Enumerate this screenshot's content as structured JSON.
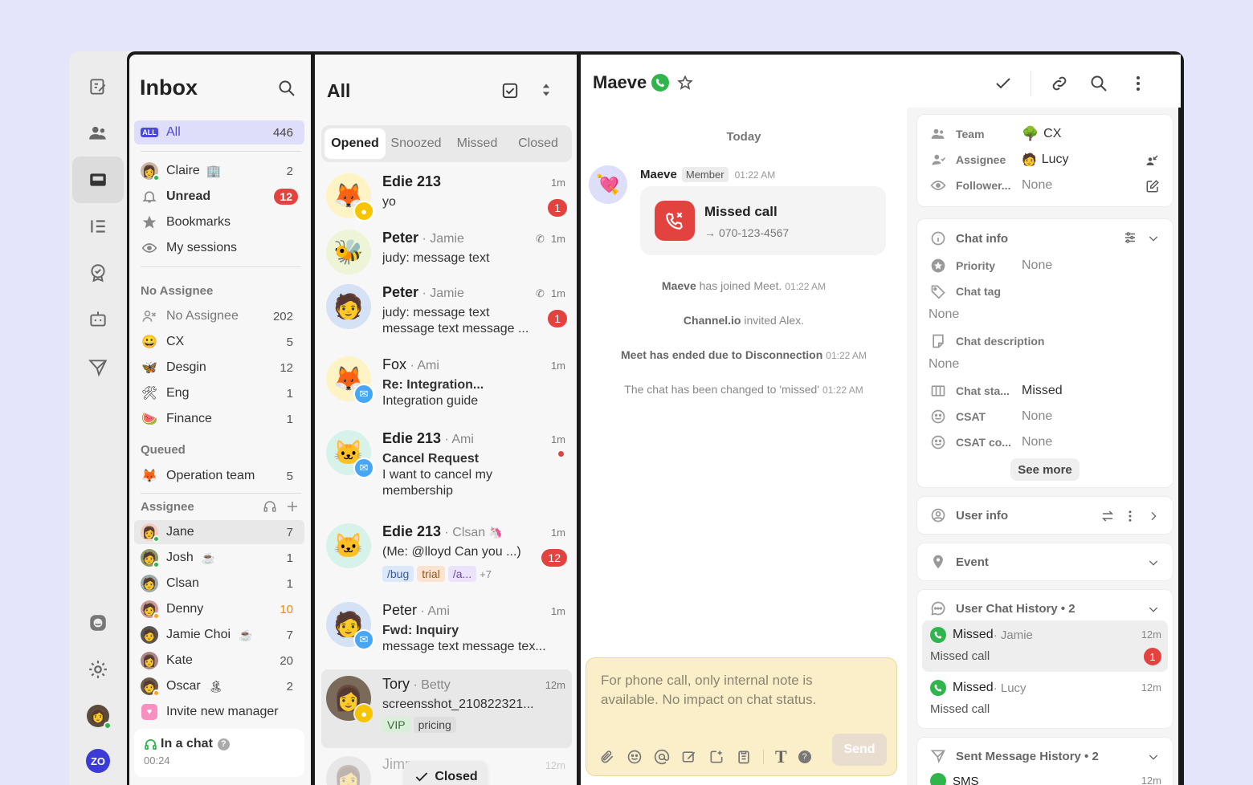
{
  "rail": {
    "items": [
      "compose-icon",
      "contacts-icon",
      "inbox-icon",
      "list-icon",
      "badge-icon",
      "bot-icon",
      "send-icon",
      "channel-icon",
      "settings-icon"
    ],
    "profile_label": "ZO"
  },
  "inbox": {
    "title": "Inbox",
    "all": {
      "label": "All",
      "count": "446",
      "icon_text": "ALL"
    },
    "items": [
      {
        "label": "Claire",
        "count": "2"
      },
      {
        "label": "Unread",
        "count": "12"
      },
      {
        "label": "Bookmarks",
        "count": ""
      },
      {
        "label": "My sessions",
        "count": ""
      }
    ],
    "no_assignee_header": "No Assignee",
    "teams": [
      {
        "label": "No Assignee",
        "count": "202",
        "emoji": ""
      },
      {
        "label": "CX",
        "count": "5",
        "emoji": "😀"
      },
      {
        "label": "Desgin",
        "count": "12",
        "emoji": "🦋"
      },
      {
        "label": "Eng",
        "count": "1",
        "emoji": "🛠"
      },
      {
        "label": "Finance",
        "count": "1",
        "emoji": "🍉"
      }
    ],
    "queued_header": "Queued",
    "queued": [
      {
        "label": "Operation team",
        "count": "5",
        "emoji": "🦊"
      }
    ],
    "assignee_header": "Assignee",
    "assignees": [
      {
        "label": "Jane",
        "count": "7",
        "extra": ""
      },
      {
        "label": "Josh",
        "count": "1",
        "extra": "☕"
      },
      {
        "label": "Clsan",
        "count": "1",
        "extra": ""
      },
      {
        "label": "Denny",
        "count": "10",
        "extra": ""
      },
      {
        "label": "Jamie Choi",
        "count": "7",
        "extra": "☕"
      },
      {
        "label": "Kate",
        "count": "20",
        "extra": ""
      },
      {
        "label": "Oscar",
        "count": "2",
        "extra": "🏝"
      }
    ],
    "invite": "Invite new manager",
    "status": {
      "label": "In a chat",
      "time": "00:24"
    }
  },
  "list": {
    "title": "All",
    "tabs": [
      "Opened",
      "Snoozed",
      "Missed",
      "Closed"
    ],
    "conversations": [
      {
        "name": "Edie 213",
        "sub": "",
        "time": "1m",
        "line1": "yo",
        "line2": "",
        "badge": "1",
        "emoji": "🦊"
      },
      {
        "name": "Peter",
        "sub": " · Jamie",
        "time": "1m",
        "line1": "judy: message text",
        "line2": "",
        "badge": "",
        "emoji": "🐝"
      },
      {
        "name": "Peter",
        "sub": " · Jamie",
        "time": "1m",
        "line1": "judy: message text",
        "line2": "message text message ...",
        "badge": "1",
        "emoji": "🧑"
      },
      {
        "name": "Fox",
        "sub": " · Ami",
        "time": "1m",
        "line1": "Re: Integration...",
        "line2": "Integration guide",
        "badge": "",
        "emoji": "🦊"
      },
      {
        "name": "Edie 213",
        "sub": " · Ami",
        "time": "1m",
        "line1": "Cancel Request",
        "line2": "I want to cancel my",
        "line3": "membership",
        "badge": "",
        "emoji": "🐱"
      },
      {
        "name": "Edie 213",
        "sub": " · Clsan",
        "time": "1m",
        "line1": "(Me: @lloyd Can you ...)",
        "line2": "",
        "badge": "12",
        "emoji": "🐱",
        "tags": [
          "/bug",
          "trial",
          "/a..."
        ],
        "more": "+7"
      },
      {
        "name": "Peter",
        "sub": " · Ami",
        "time": "1m",
        "line1": "Fwd: Inquiry",
        "line2": "message text message tex...",
        "badge": "",
        "emoji": "🧑"
      },
      {
        "name": "Tory",
        "sub": " · Betty",
        "time": "12m",
        "line1": "screensshot_210822321...",
        "line2": "",
        "badge": "",
        "emoji": "👩",
        "tags": [
          "VIP",
          "pricing"
        ]
      },
      {
        "name": "Jimm",
        "sub": "",
        "time": "12m",
        "line1": "",
        "line2": "",
        "badge": "",
        "emoji": "👩"
      }
    ],
    "toast": "Closed"
  },
  "chat": {
    "name": "Maeve",
    "date_divider": "Today",
    "message": {
      "sender": "Maeve",
      "role": "Member",
      "time": "01:22 AM",
      "title": "Missed call",
      "number": "070-123-4567"
    },
    "system": [
      {
        "b": "Maeve",
        "text": " has joined Meet.",
        "time": "01:22 AM"
      },
      {
        "b": "Channel.io",
        "text": " invited Alex.",
        "time": ""
      },
      {
        "b": "Meet has ended due to Disconnection",
        "text": "",
        "time": "01:22 AM"
      },
      {
        "b": "",
        "text": "The chat has been changed to 'missed'",
        "time": "01:22 AM"
      }
    ],
    "composer_placeholder": "For phone call, only internal note is available. No impact on chat status.",
    "send_label": "Send"
  },
  "side": {
    "team_label": "Team",
    "team_value": "CX",
    "assignee_label": "Assignee",
    "assignee_value": "Lucy",
    "follower_label": "Follower...",
    "follower_value": "None",
    "chat_info": "Chat info",
    "priority_label": "Priority",
    "priority_value": "None",
    "chat_tag_label": "Chat tag",
    "chat_tag_value": "None",
    "desc_label": "Chat description",
    "desc_value": "None",
    "status_label": "Chat sta...",
    "status_value": "Missed",
    "csat_label": "CSAT",
    "csat_value": "None",
    "csat_co_label": "CSAT co...",
    "csat_co_value": "None",
    "see_more": "See more",
    "user_info": "User info",
    "event": "Event",
    "history_title": "User Chat History • 2",
    "history": [
      {
        "title": "Missed",
        "sub": " · Jamie",
        "time": "12m",
        "line": "Missed call",
        "badge": "1"
      },
      {
        "title": "Missed",
        "sub": " · Lucy",
        "time": "12m",
        "line": "Missed call",
        "badge": ""
      }
    ],
    "sent_title": "Sent Message History • 2",
    "sent_first": "SMS",
    "sent_first_time": "12m"
  },
  "colors": {
    "accent": "#4a4ad8",
    "badge": "#e3433f",
    "phone": "#2fb54c",
    "composer": "#fbefc9"
  }
}
